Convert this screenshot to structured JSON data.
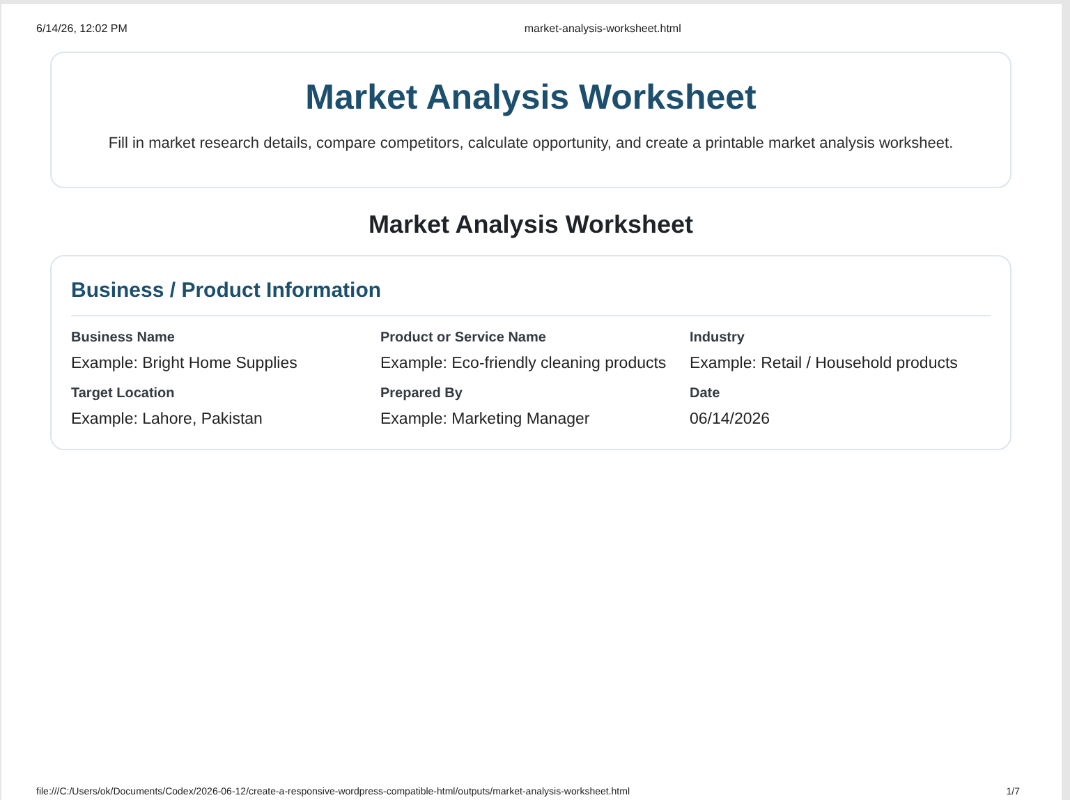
{
  "print_header": {
    "date_time": "6/14/26, 12:02 PM",
    "file_name": "market-analysis-worksheet.html"
  },
  "hero": {
    "title": "Market Analysis Worksheet",
    "subtitle": "Fill in market research details, compare competitors, calculate opportunity, and create a printable market analysis worksheet."
  },
  "worksheet_title": "Market Analysis Worksheet",
  "section": {
    "title": "Business / Product Information",
    "fields": [
      {
        "label": "Business Name",
        "placeholder": "Example: Bright Home Supplies"
      },
      {
        "label": "Product or Service Name",
        "placeholder": "Example: Eco-friendly cleaning products"
      },
      {
        "label": "Industry",
        "placeholder": "Example: Retail / Household products"
      },
      {
        "label": "Target Location",
        "placeholder": "Example: Lahore, Pakistan"
      },
      {
        "label": "Prepared By",
        "placeholder": "Example: Marketing Manager"
      },
      {
        "label": "Date",
        "value": "06/14/2026"
      }
    ]
  },
  "print_footer": {
    "url": "file:///C:/Users/ok/Documents/Codex/2026-06-12/create-a-responsive-wordpress-compatible-html/outputs/market-analysis-worksheet.html",
    "page": "1/7"
  }
}
